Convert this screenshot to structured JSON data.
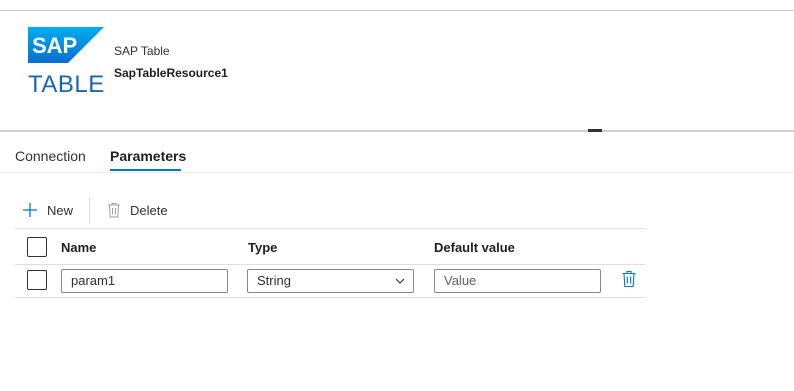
{
  "header": {
    "logo_brand": "SAP",
    "logo_word": "TABLE",
    "dataset_type": "SAP Table",
    "dataset_name": "SapTableResource1"
  },
  "tabs": [
    {
      "label": "Connection",
      "active": false
    },
    {
      "label": "Parameters",
      "active": true
    }
  ],
  "toolbar": {
    "new_label": "New",
    "delete_label": "Delete"
  },
  "grid": {
    "columns": [
      "Name",
      "Type",
      "Default value"
    ],
    "rows": [
      {
        "name": "param1",
        "type": "String",
        "default_placeholder": "Value",
        "default_value": ""
      }
    ]
  },
  "colors": {
    "accent": "#0078d4",
    "sap_blue": "#1866b4",
    "text": "#323130"
  },
  "icons": [
    "plus-icon",
    "trash-icon",
    "chevron-down-icon",
    "sap-logo"
  ]
}
